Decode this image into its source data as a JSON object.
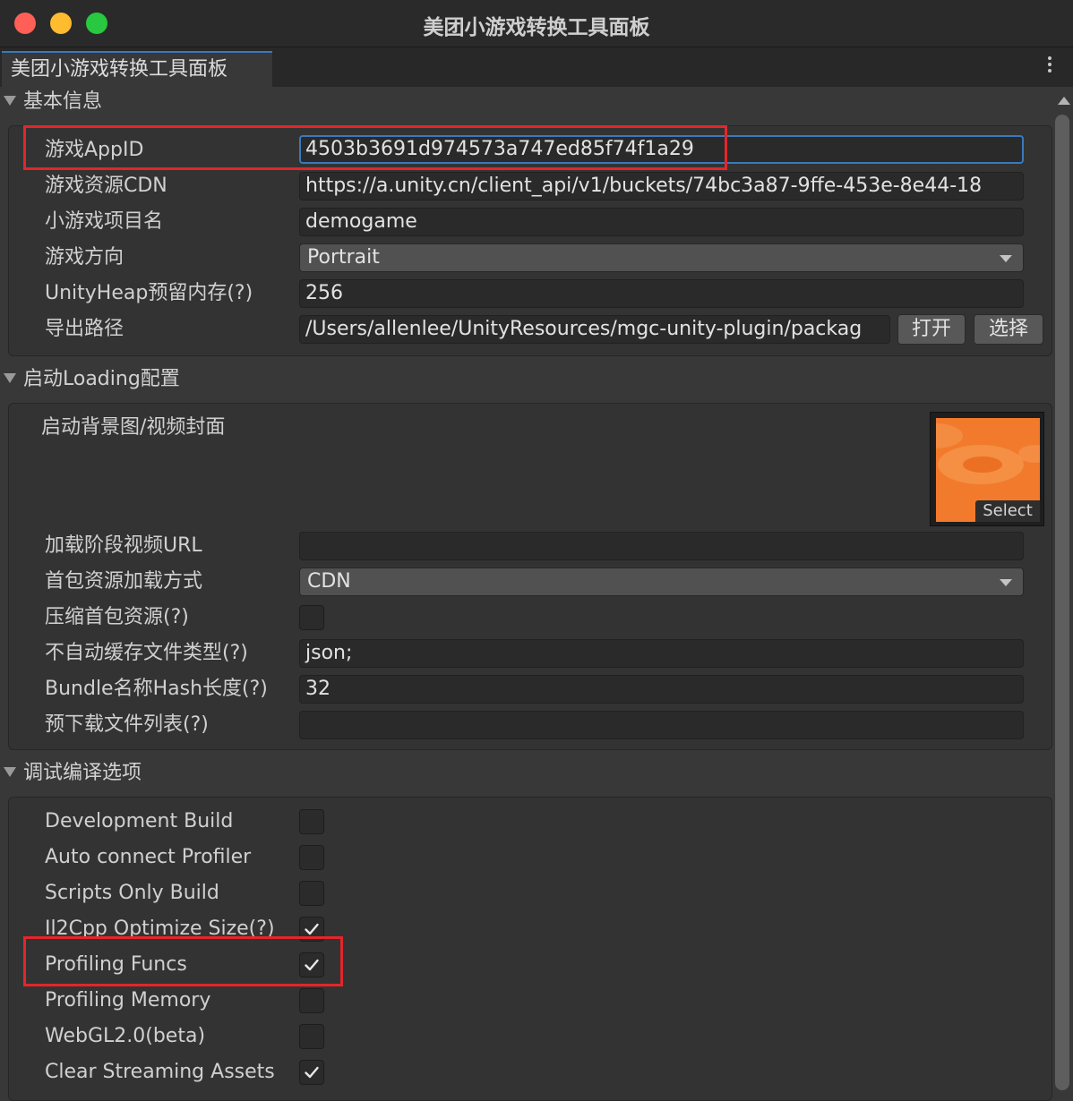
{
  "window": {
    "title": "美团小游戏转换工具面板",
    "tab_label": "美团小游戏转换工具面板",
    "colors": {
      "close": "#fe5f57",
      "minimize": "#febc2e",
      "zoom": "#28c840",
      "accent": "#3a79bb",
      "highlight": "#e3262a"
    }
  },
  "basic": {
    "header": "基本信息",
    "appid_label": "游戏AppID",
    "appid_value": "4503b3691d974573a747ed85f74f1a29",
    "cdn_label": "游戏资源CDN",
    "cdn_value": "https://a.unity.cn/client_api/v1/buckets/74bc3a87-9ffe-453e-8e44-18",
    "name_label": "小游戏项目名",
    "name_value": "demogame",
    "orientation_label": "游戏方向",
    "orientation_value": "Portrait",
    "heap_label": "UnityHeap预留内存(?)",
    "heap_value": "256",
    "export_label": "导出路径",
    "export_value": "/Users/allenlee/UnityResources/mgc-unity-plugin/packag",
    "open_button": "打开",
    "select_button": "选择"
  },
  "loading": {
    "header": "启动Loading配置",
    "bg_label": "启动背景图/视频封面",
    "thumb_select": "Select",
    "video_label": "加载阶段视频URL",
    "video_value": "",
    "load_mode_label": "首包资源加载方式",
    "load_mode_value": "CDN",
    "compress_label": "压缩首包资源(?)",
    "compress_checked": false,
    "nocache_label": "不自动缓存文件类型(?)",
    "nocache_value": "json;",
    "hash_label": "Bundle名称Hash长度(?)",
    "hash_value": "32",
    "preload_label": "预下载文件列表(?)",
    "preload_value": ""
  },
  "debug": {
    "header": "调试编译选项",
    "options": [
      {
        "label": "Development Build",
        "checked": false
      },
      {
        "label": "Auto connect Profiler",
        "checked": false
      },
      {
        "label": "Scripts Only Build",
        "checked": false
      },
      {
        "label": "Il2Cpp Optimize Size(?)",
        "checked": true
      },
      {
        "label": "Profiling Funcs",
        "checked": true
      },
      {
        "label": "Profiling Memory",
        "checked": false
      },
      {
        "label": "WebGL2.0(beta)",
        "checked": false
      },
      {
        "label": "Clear Streaming Assets",
        "checked": true
      }
    ]
  }
}
